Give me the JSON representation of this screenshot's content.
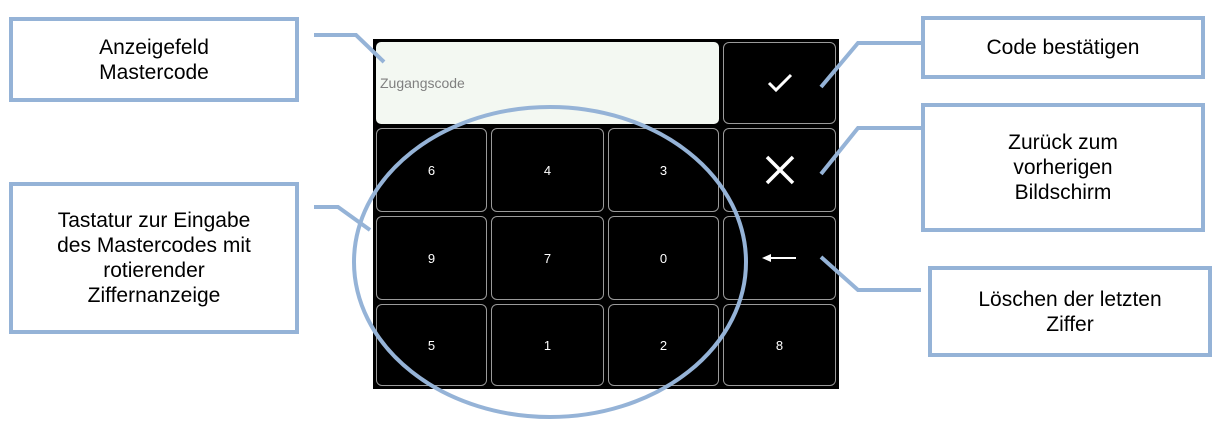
{
  "display": {
    "placeholder": "Zugangscode"
  },
  "keypad": {
    "rows": [
      [
        "6",
        "4",
        "3"
      ],
      [
        "9",
        "7",
        "0"
      ],
      [
        "5",
        "1",
        "2"
      ]
    ],
    "extra_key": "8"
  },
  "side_buttons": {
    "confirm_icon": "checkmark-icon",
    "cancel_icon": "close-icon",
    "backspace_icon": "arrow-left-icon"
  },
  "callouts": {
    "display_field": "Anzeigefeld\nMastercode",
    "keyboard": "Tastatur zur Eingabe\ndes Mastercodes mit\nrotierender\nZiffernanzeige",
    "confirm": "Code bestätigen",
    "back": "Zurück zum\nvorherigen\nBildschirm",
    "delete": "Löschen der letzten\nZiffer"
  },
  "colors": {
    "callout_border": "#95b3d7",
    "screen_background": "#000000",
    "display_background": "#f3f8f2",
    "key_border": "#9a9a9a"
  }
}
